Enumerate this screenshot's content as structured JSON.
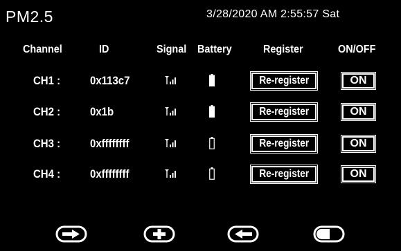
{
  "header": {
    "title": "PM2.5",
    "datetime": "3/28/2020 AM 2:55:57 Sat"
  },
  "columns": {
    "channel": "Channel",
    "id": "ID",
    "signal": "Signal",
    "battery": "Battery",
    "register": "Register",
    "onoff": "ON/OFF"
  },
  "rows": [
    {
      "channel": "CH1 :",
      "id": "0x113c7",
      "signal_icon": "signal-icon",
      "battery_icon": "battery-full-icon",
      "battery_level": 1.0,
      "register_label": "Re-register",
      "onoff_label": "ON"
    },
    {
      "channel": "CH2 :",
      "id": "0x1b",
      "signal_icon": "signal-icon",
      "battery_icon": "battery-full-icon",
      "battery_level": 1.0,
      "register_label": "Re-register",
      "onoff_label": "ON"
    },
    {
      "channel": "CH3 :",
      "id": "0xffffffff",
      "signal_icon": "signal-icon",
      "battery_icon": "battery-empty-icon",
      "battery_level": 0.0,
      "register_label": "Re-register",
      "onoff_label": "ON"
    },
    {
      "channel": "CH4 :",
      "id": "0xffffffff",
      "signal_icon": "signal-icon",
      "battery_icon": "battery-empty-icon",
      "battery_level": 0.0,
      "register_label": "Re-register",
      "onoff_label": "ON"
    }
  ],
  "nav": [
    {
      "icon": "arrow-right-icon"
    },
    {
      "icon": "plus-icon"
    },
    {
      "icon": "arrow-left-icon"
    },
    {
      "icon": "toggle-icon"
    }
  ],
  "colors": {
    "background": "#000000",
    "foreground": "#ffffff"
  }
}
